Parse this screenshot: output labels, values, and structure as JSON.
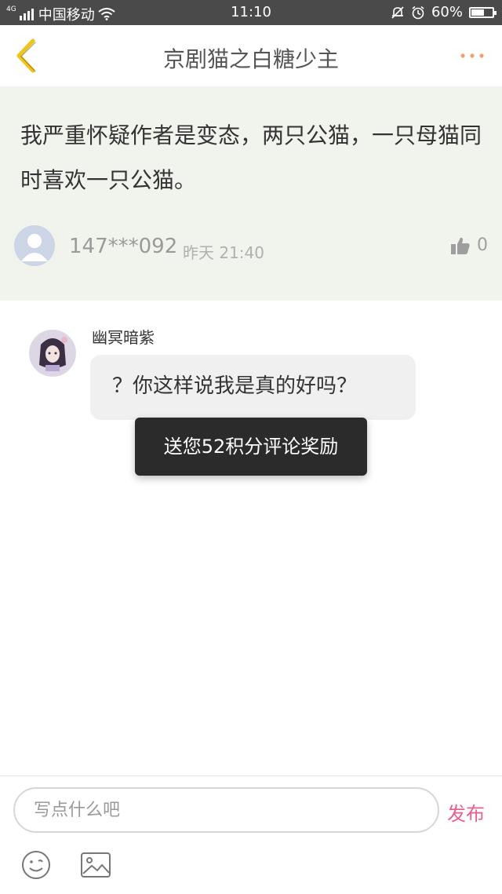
{
  "status_bar": {
    "network": "4G",
    "carrier": "中国移动",
    "time": "11:10",
    "battery": "60%",
    "battery_level": 0.6
  },
  "header": {
    "title": "京剧猫之白糖少主"
  },
  "post": {
    "text": "我严重怀疑作者是变态，两只公猫，一只母猫同时喜欢一只公猫。",
    "username": "147***092",
    "time": "昨天 21:40",
    "likes": "0"
  },
  "comment": {
    "username": "幽冥暗紫",
    "text": "？你这样说我是真的好吗？"
  },
  "toast": {
    "text": "送您52积分评论奖励"
  },
  "bottom_bar": {
    "input_placeholder": "写点什么吧",
    "send_label": "发布"
  },
  "colors": {
    "accent": "#e8608c",
    "back_arrow": "#f0c419",
    "more_dots": "#f0a070",
    "post_background": "#f1f3ed"
  }
}
